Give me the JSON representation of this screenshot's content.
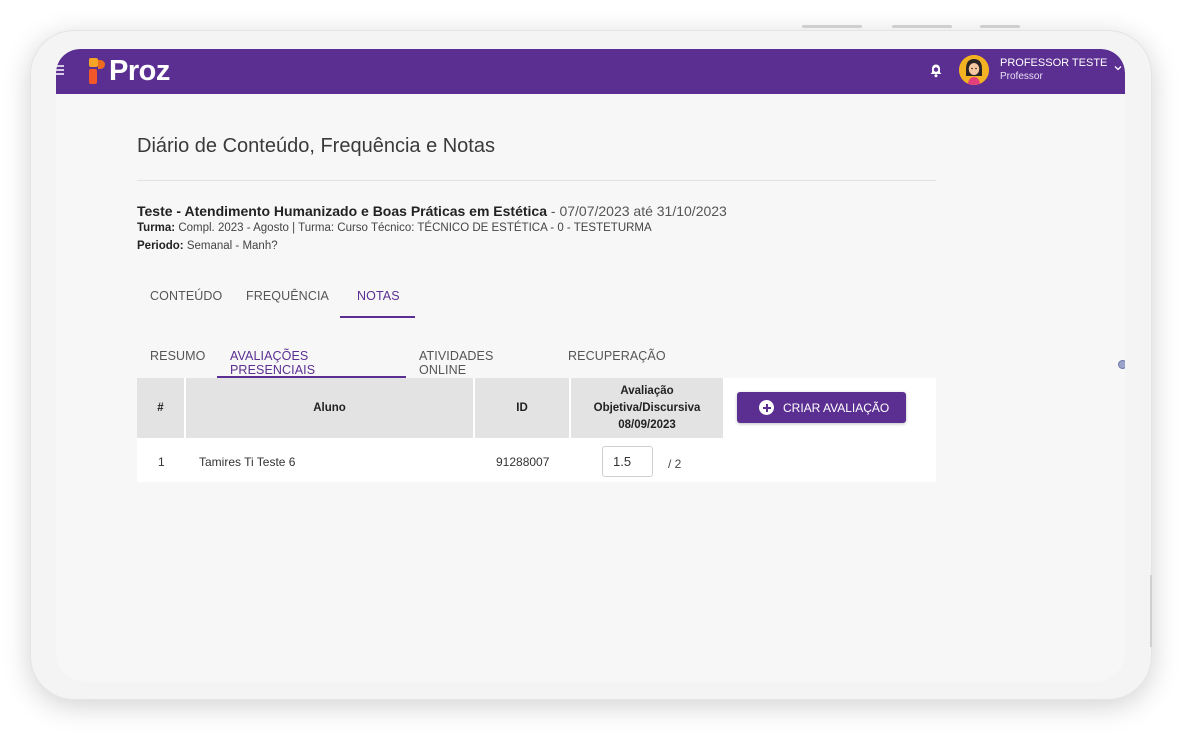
{
  "header": {
    "brand": "Proz",
    "user_name": "PROFESSOR TESTE",
    "user_role": "Professor"
  },
  "page": {
    "title": "Diário de Conteúdo, Frequência e Notas"
  },
  "course": {
    "name": "Teste - Atendimento Humanizado e Boas Práticas em Estética",
    "dates": " - 07/07/2023 até 31/10/2023",
    "turma_label": "Turma:",
    "turma_value": "Compl. 2023 - Agosto | Turma: Curso Técnico: TÉCNICO DE ESTÉTICA - 0 - TESTETURMA",
    "periodo_label": "Periodo:",
    "periodo_value": "Semanal - Manh?"
  },
  "tabs": [
    {
      "label": "CONTEÚDO",
      "active": false
    },
    {
      "label": "FREQUÊNCIA",
      "active": false
    },
    {
      "label": "NOTAS",
      "active": true
    }
  ],
  "subtabs": [
    {
      "label": "RESUMO",
      "active": false
    },
    {
      "label": "AVALIAÇÕES PRESENCIAIS",
      "active": true
    },
    {
      "label": "ATIVIDADES ONLINE",
      "active": false
    },
    {
      "label": "RECUPERAÇÃO",
      "active": false
    }
  ],
  "table": {
    "headers": {
      "num": "#",
      "aluno": "Aluno",
      "id": "ID",
      "aval_line1": "Avaliação",
      "aval_line2": "Objetiva/Discursiva",
      "aval_line3": "08/09/2023"
    },
    "rows": [
      {
        "num": "1",
        "aluno": "Tamires Ti Teste 6",
        "id": "91288007",
        "grade": "1.5",
        "max": "/ 2"
      }
    ]
  },
  "actions": {
    "create_label": "CRIAR AVALIAÇÃO"
  },
  "colors": {
    "brand": "#5b2f91",
    "logo_orange": "#f2572a",
    "logo_yellow": "#f7a326"
  }
}
